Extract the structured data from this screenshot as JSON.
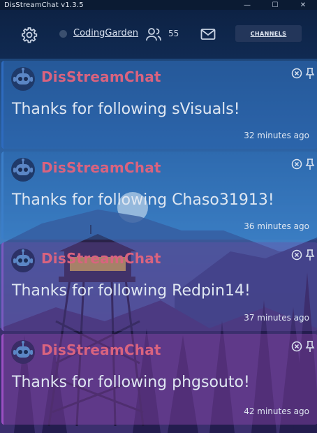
{
  "window": {
    "title": "DisStreamChat v1.3.5",
    "minimize": "—",
    "maximize": "☐",
    "close": "✕"
  },
  "header": {
    "channel_name": "CodingGarden",
    "viewer_count": "55",
    "channels_button": "CHANNELS"
  },
  "messages": [
    {
      "sender": "DisStreamChat",
      "text": "Thanks for following sVisuals!",
      "time": "32 minutes ago"
    },
    {
      "sender": "DisStreamChat",
      "text": "Thanks for following Chaso31913!",
      "time": "36 minutes ago"
    },
    {
      "sender": "DisStreamChat",
      "text": "Thanks for following Redpin14!",
      "time": "37 minutes ago"
    },
    {
      "sender": "DisStreamChat",
      "text": "Thanks for following phgsouto!",
      "time": "42 minutes ago"
    }
  ],
  "colors": {
    "sender": "#d9637f",
    "header_bg": "#0d2244",
    "card_blue": "#2b62a8",
    "card_purple": "#6c3e96"
  },
  "icons": {
    "settings": "gear-icon",
    "status": "status-dot",
    "viewers": "viewers-icon",
    "mail": "mail-icon",
    "dismiss": "close-icon",
    "pin": "pin-icon",
    "avatar": "robot-avatar-icon"
  }
}
